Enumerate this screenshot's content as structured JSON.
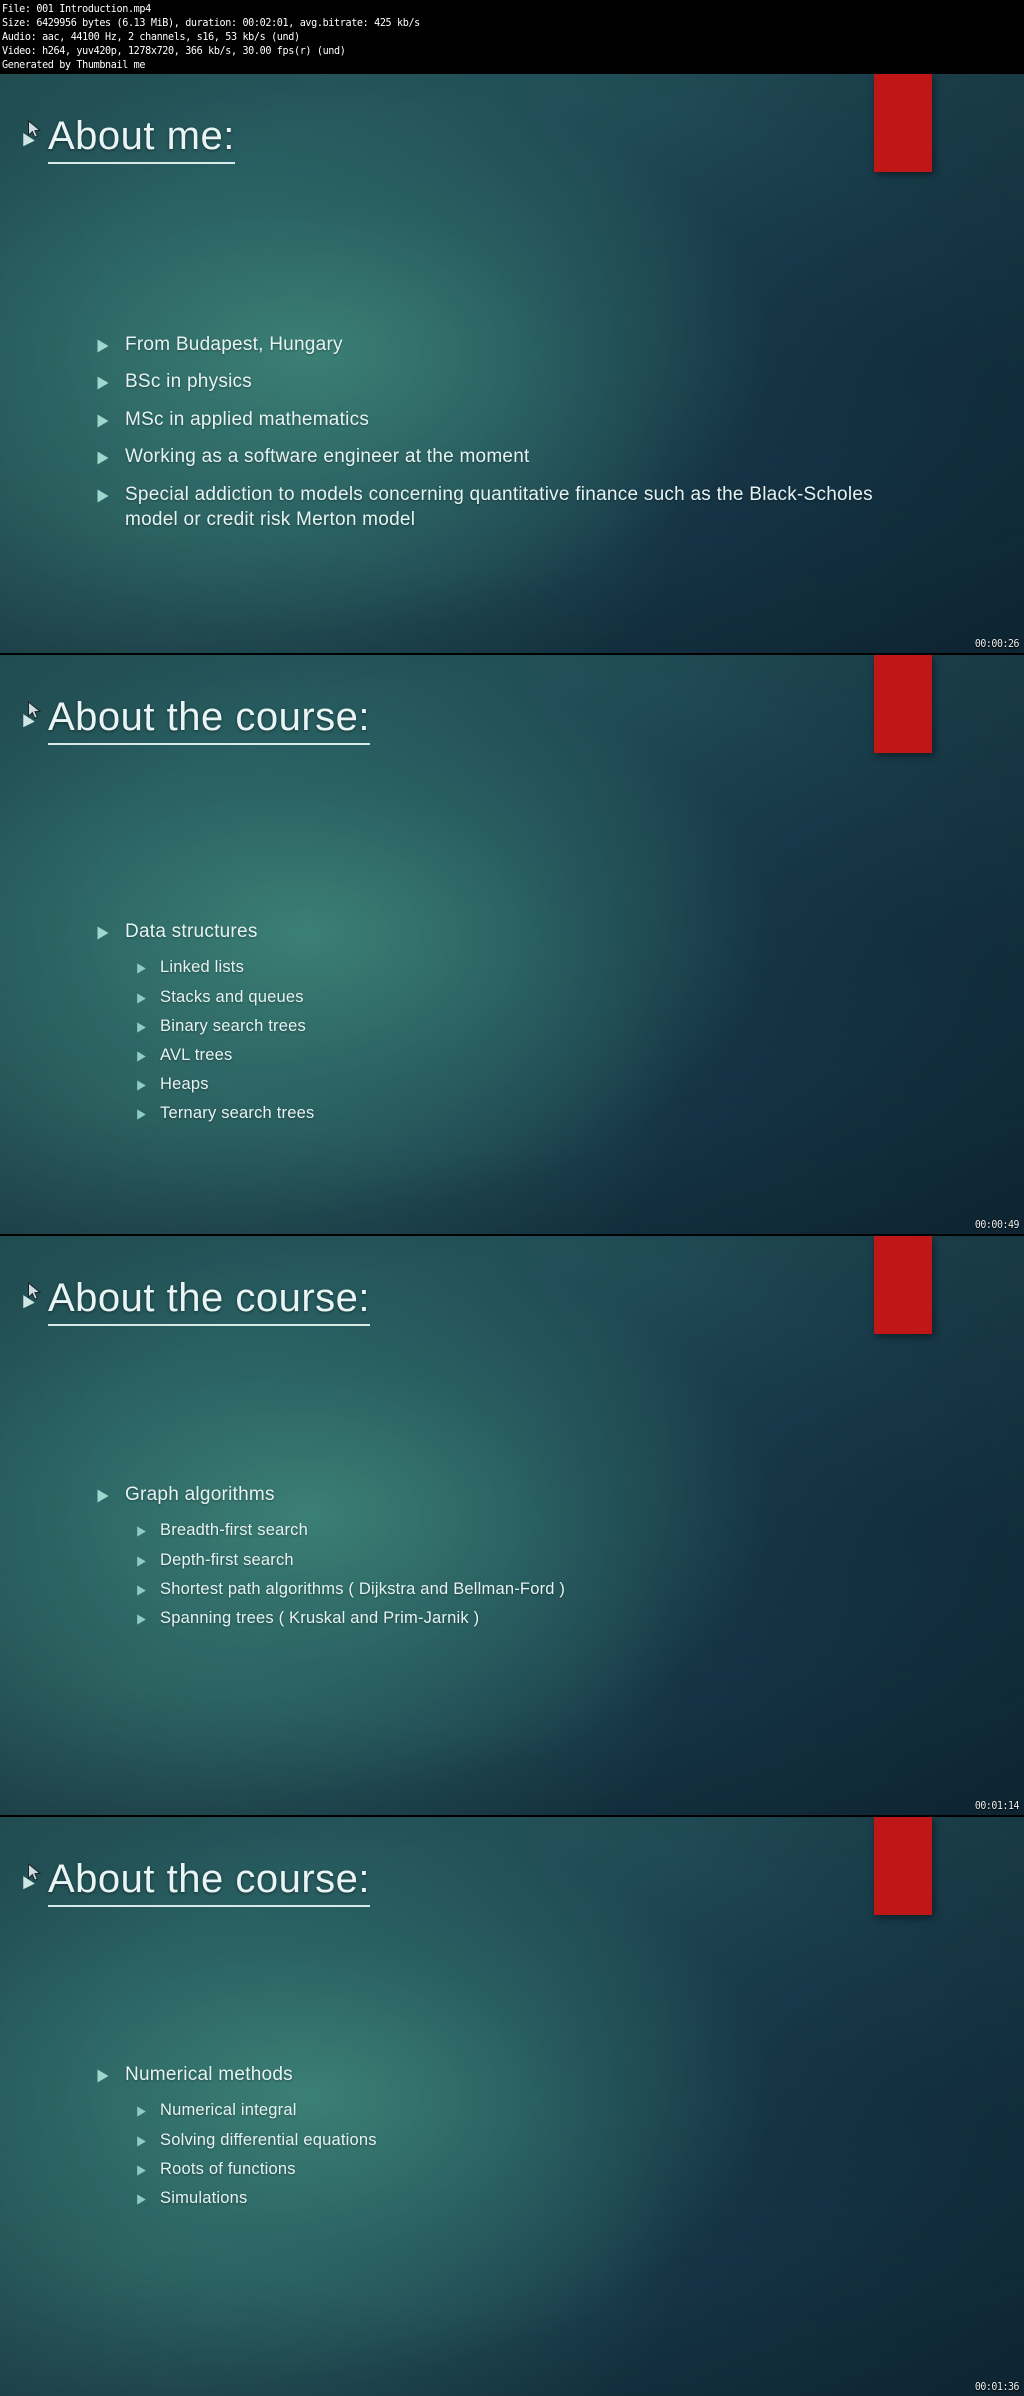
{
  "meta_header": {
    "lines": [
      "File: 001 Introduction.mp4",
      "Size: 6429956 bytes (6.13 MiB), duration: 00:02:01, avg.bitrate: 425 kb/s",
      "Audio: aac, 44100 Hz, 2 channels, s16, 53 kb/s (und)",
      "Video: h264, yuv420p, 1278x720, 366 kb/s, 30.00 fps(r) (und)",
      "Generated by Thumbnail me"
    ]
  },
  "theme": {
    "accent_color": "#bf1717",
    "text_color": "#e6f3f2",
    "bullet_color": "#9fd6ce"
  },
  "slides": [
    {
      "title": "About me:",
      "timestamp": "00:00:26",
      "cursor": true,
      "bullets": [
        {
          "level": 1,
          "text": "From Budapest, Hungary"
        },
        {
          "level": 1,
          "text": "BSc in physics"
        },
        {
          "level": 1,
          "text": "MSc in applied mathematics"
        },
        {
          "level": 1,
          "text": "Working as a software engineer at the moment"
        },
        {
          "level": 1,
          "text": "Special addiction to models concerning quantitative finance such as the Black-Scholes model or credit risk Merton model"
        }
      ]
    },
    {
      "title": "About the course:",
      "timestamp": "00:00:49",
      "cursor": true,
      "bullets": [
        {
          "level": 1,
          "text": "Data structures"
        },
        {
          "level": 2,
          "text": "Linked lists"
        },
        {
          "level": 2,
          "text": "Stacks and queues"
        },
        {
          "level": 2,
          "text": "Binary search trees"
        },
        {
          "level": 2,
          "text": "AVL trees"
        },
        {
          "level": 2,
          "text": "Heaps"
        },
        {
          "level": 2,
          "text": "Ternary search trees"
        }
      ]
    },
    {
      "title": "About the course:",
      "timestamp": "00:01:14",
      "cursor": true,
      "bullets": [
        {
          "level": 1,
          "text": "Graph algorithms"
        },
        {
          "level": 2,
          "text": "Breadth-first search"
        },
        {
          "level": 2,
          "text": "Depth-first search"
        },
        {
          "level": 2,
          "text": "Shortest path algorithms  ( Dijkstra and Bellman-Ford )"
        },
        {
          "level": 2,
          "text": "Spanning trees ( Kruskal and Prim-Jarnik )"
        }
      ]
    },
    {
      "title": "About the course:",
      "timestamp": "00:01:36",
      "cursor": true,
      "bullets": [
        {
          "level": 1,
          "text": "Numerical methods"
        },
        {
          "level": 2,
          "text": "Numerical integral"
        },
        {
          "level": 2,
          "text": "Solving differential equations"
        },
        {
          "level": 2,
          "text": "Roots of functions"
        },
        {
          "level": 2,
          "text": "Simulations"
        }
      ]
    }
  ]
}
